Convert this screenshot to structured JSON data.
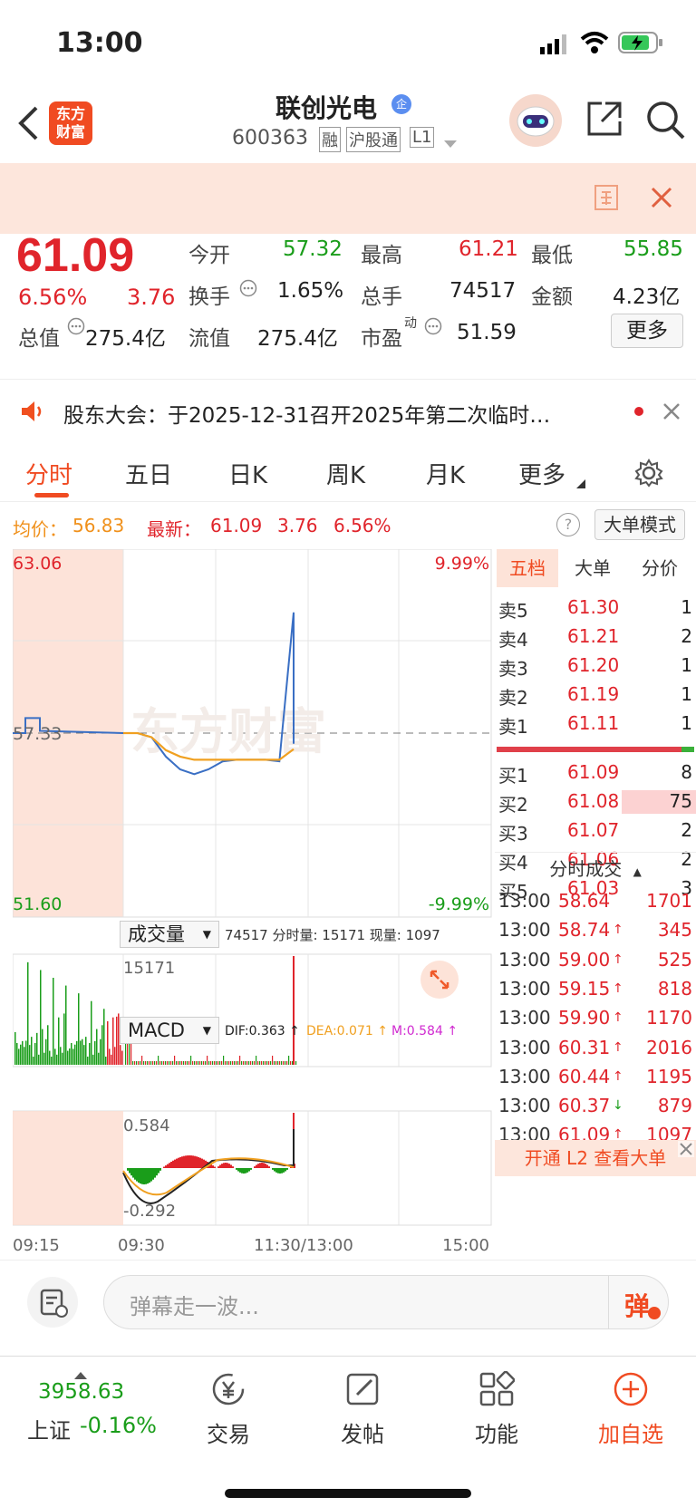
{
  "status": {
    "time": "13:00"
  },
  "nav": {
    "logo_text": "东方财富",
    "stock_name": "联创光电",
    "qi_badge": "企",
    "code": "600363",
    "tags": [
      "融",
      "沪股通",
      "L1"
    ]
  },
  "banner": {
    "icon": "info-icon",
    "close": "close-icon"
  },
  "quote": {
    "price": "61.09",
    "pct": "6.56%",
    "chg": "3.76",
    "fields": [
      {
        "label": "今开",
        "value": "57.32",
        "color": "green"
      },
      {
        "label": "最高",
        "value": "61.21",
        "color": "red"
      },
      {
        "label": "最低",
        "value": "55.85",
        "color": "green"
      },
      {
        "label": "换手",
        "value": "1.65%",
        "color": "dark"
      },
      {
        "label": "总手",
        "value": "74517",
        "color": "dark"
      },
      {
        "label": "金额",
        "value": "4.23亿",
        "color": "dark"
      },
      {
        "label": "总值",
        "value": "275.4亿",
        "color": "dark"
      },
      {
        "label": "流值",
        "value": "275.4亿",
        "color": "dark"
      },
      {
        "label": "市盈",
        "sup": "动",
        "value": "51.59",
        "color": "dark"
      }
    ],
    "more_btn": "更多"
  },
  "notice": {
    "text": "股东大会：于2025-12-31召开2025年第二次临时…"
  },
  "tabs": [
    "分时",
    "五日",
    "日K",
    "周K",
    "月K",
    "更多"
  ],
  "infoline": {
    "avg_label": "均价：",
    "avg": "56.83",
    "latest_label": "最新：",
    "latest": "61.09",
    "chg": "3.76",
    "pct": "6.56%",
    "mode_btn": "大单模式"
  },
  "chart": {
    "price_top": "63.06",
    "price_bottom": "51.60",
    "pct_top": "9.99%",
    "pct_bottom": "-9.99%",
    "ref_price": "57.33",
    "watermark": "东方财富",
    "vol_select": "成交量",
    "vol_info": "74517 分时量: 15171 现量: 1097",
    "vol_max": "15171",
    "macd_select": "MACD",
    "dif": "DIF:0.363 ↑",
    "dea": "DEA:0.071 ↑",
    "m": "M:0.584 ↑",
    "macd_top": "0.584",
    "macd_bottom": "-0.292",
    "time_labels": [
      "09:15",
      "09:30",
      "11:30/13:00",
      "15:00"
    ]
  },
  "chart_data": {
    "type": "line",
    "title": "",
    "x": [
      0,
      10,
      20,
      30,
      40,
      50,
      60,
      70,
      80,
      90,
      100,
      110,
      120
    ],
    "series": [
      {
        "name": "",
        "values": [
          57.33,
          57.33,
          57.2,
          56.6,
          56.2,
          56.05,
          56.2,
          56.45,
          56.5,
          56.5,
          56.5,
          56.45,
          61.09
        ]
      },
      {
        "name": "均价",
        "values": [
          57.33,
          57.33,
          57.2,
          56.8,
          56.6,
          56.5,
          56.5,
          56.5,
          56.5,
          56.5,
          56.5,
          56.5,
          56.83
        ]
      }
    ],
    "ylim": [
      51.6,
      63.06
    ]
  },
  "orderbook": {
    "tabs": [
      "五档",
      "大单",
      "分价"
    ],
    "sells": [
      {
        "label": "卖5",
        "price": "61.30",
        "vol": "1"
      },
      {
        "label": "卖4",
        "price": "61.21",
        "vol": "2"
      },
      {
        "label": "卖3",
        "price": "61.20",
        "vol": "1"
      },
      {
        "label": "卖2",
        "price": "61.19",
        "vol": "1"
      },
      {
        "label": "卖1",
        "price": "61.11",
        "vol": "1"
      }
    ],
    "buys": [
      {
        "label": "买1",
        "price": "61.09",
        "vol": "8"
      },
      {
        "label": "买2",
        "price": "61.08",
        "vol": "75"
      },
      {
        "label": "买3",
        "price": "61.07",
        "vol": "2"
      },
      {
        "label": "买4",
        "price": "61.06",
        "vol": "2"
      },
      {
        "label": "买5",
        "price": "61.03",
        "vol": "3"
      }
    ],
    "trades_title": "分时成交",
    "trades": [
      {
        "time": "13:00",
        "price": "58.64",
        "arrow": "",
        "vol": "1701"
      },
      {
        "time": "13:00",
        "price": "58.74",
        "arrow": "↑",
        "vol": "345"
      },
      {
        "time": "13:00",
        "price": "59.00",
        "arrow": "↑",
        "vol": "525"
      },
      {
        "time": "13:00",
        "price": "59.15",
        "arrow": "↑",
        "vol": "818"
      },
      {
        "time": "13:00",
        "price": "59.90",
        "arrow": "↑",
        "vol": "1170"
      },
      {
        "time": "13:00",
        "price": "60.31",
        "arrow": "↑",
        "vol": "2016"
      },
      {
        "time": "13:00",
        "price": "60.44",
        "arrow": "↑",
        "vol": "1195"
      },
      {
        "time": "13:00",
        "price": "60.37",
        "arrow": "↓",
        "vol": "879"
      },
      {
        "time": "13:00",
        "price": "61.09",
        "arrow": "↑",
        "vol": "1097"
      }
    ],
    "l2_btn": "开通 L2 查看大单"
  },
  "comment": {
    "placeholder": "弹幕走一波...",
    "btn": "弹"
  },
  "bottom": {
    "index_value": "3958.63",
    "index_name": "上证",
    "index_pct": "-0.16%",
    "items": [
      "交易",
      "发帖",
      "功能",
      "加自选"
    ]
  }
}
